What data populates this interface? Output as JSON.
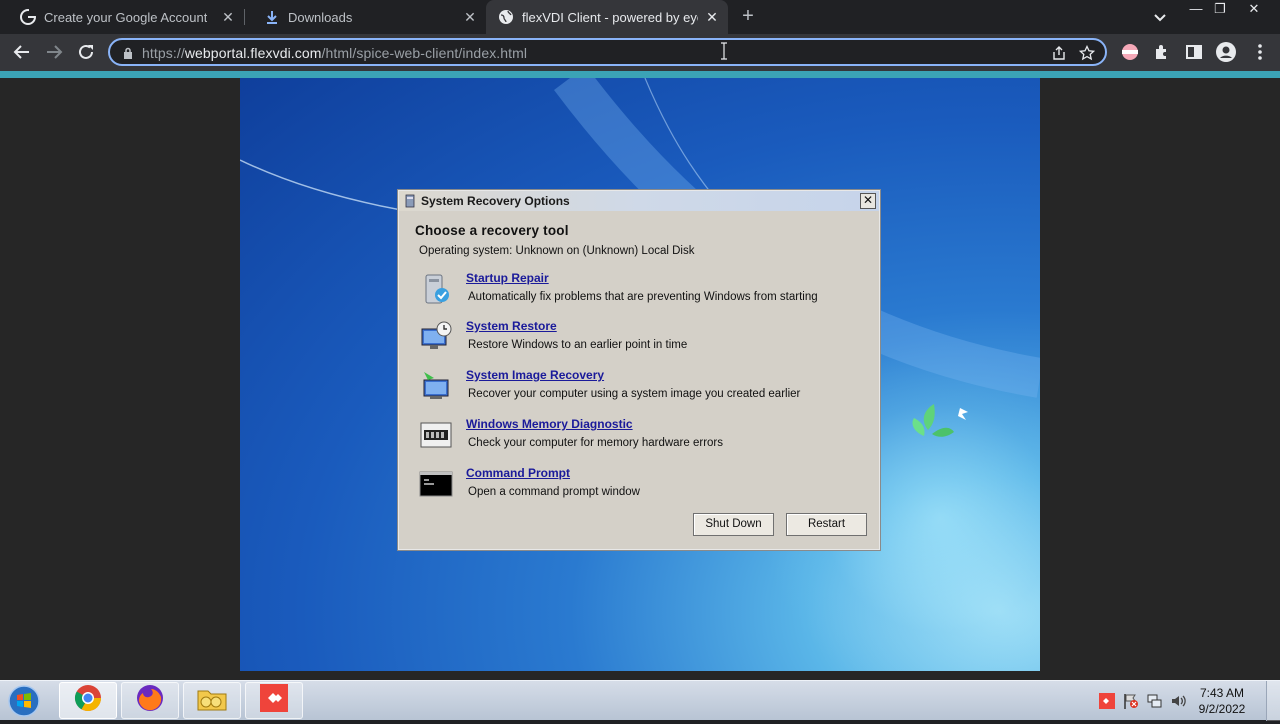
{
  "browser": {
    "tabs": [
      {
        "title": "Create your Google Account",
        "icon": "google-icon",
        "active": false
      },
      {
        "title": "Downloads",
        "icon": "download-icon",
        "active": false
      },
      {
        "title": "flexVDI Client - powered by eyeOS",
        "icon": "globe-icon",
        "active": true
      }
    ],
    "url_scheme": "https://",
    "url_host": "webportal.flexvdi.com",
    "url_path": "/html/spice-web-client/index.html",
    "accent_color": "#3ba3b6"
  },
  "dialog": {
    "title": "System Recovery Options",
    "heading": "Choose a recovery tool",
    "os_line": "Operating system: Unknown on (Unknown) Local Disk",
    "tools": [
      {
        "name": "Startup Repair",
        "desc": "Automatically fix problems that are preventing Windows from starting",
        "icon": "startup-repair-icon"
      },
      {
        "name": "System Restore",
        "desc": "Restore Windows to an earlier point in time",
        "icon": "system-restore-icon"
      },
      {
        "name": "System Image Recovery",
        "desc": "Recover your computer using a system image you created earlier",
        "icon": "system-image-recovery-icon"
      },
      {
        "name": "Windows Memory Diagnostic",
        "desc": "Check your computer for memory hardware errors",
        "icon": "memory-diagnostic-icon"
      },
      {
        "name": "Command Prompt",
        "desc": "Open a command prompt window",
        "icon": "command-prompt-icon"
      }
    ],
    "shutdown_label": "Shut Down",
    "restart_label": "Restart"
  },
  "taskbar": {
    "time": "7:43 AM",
    "date": "9/2/2022",
    "apps": [
      "chrome-icon",
      "firefox-icon",
      "file-explorer-icon",
      "anydesk-icon"
    ]
  }
}
